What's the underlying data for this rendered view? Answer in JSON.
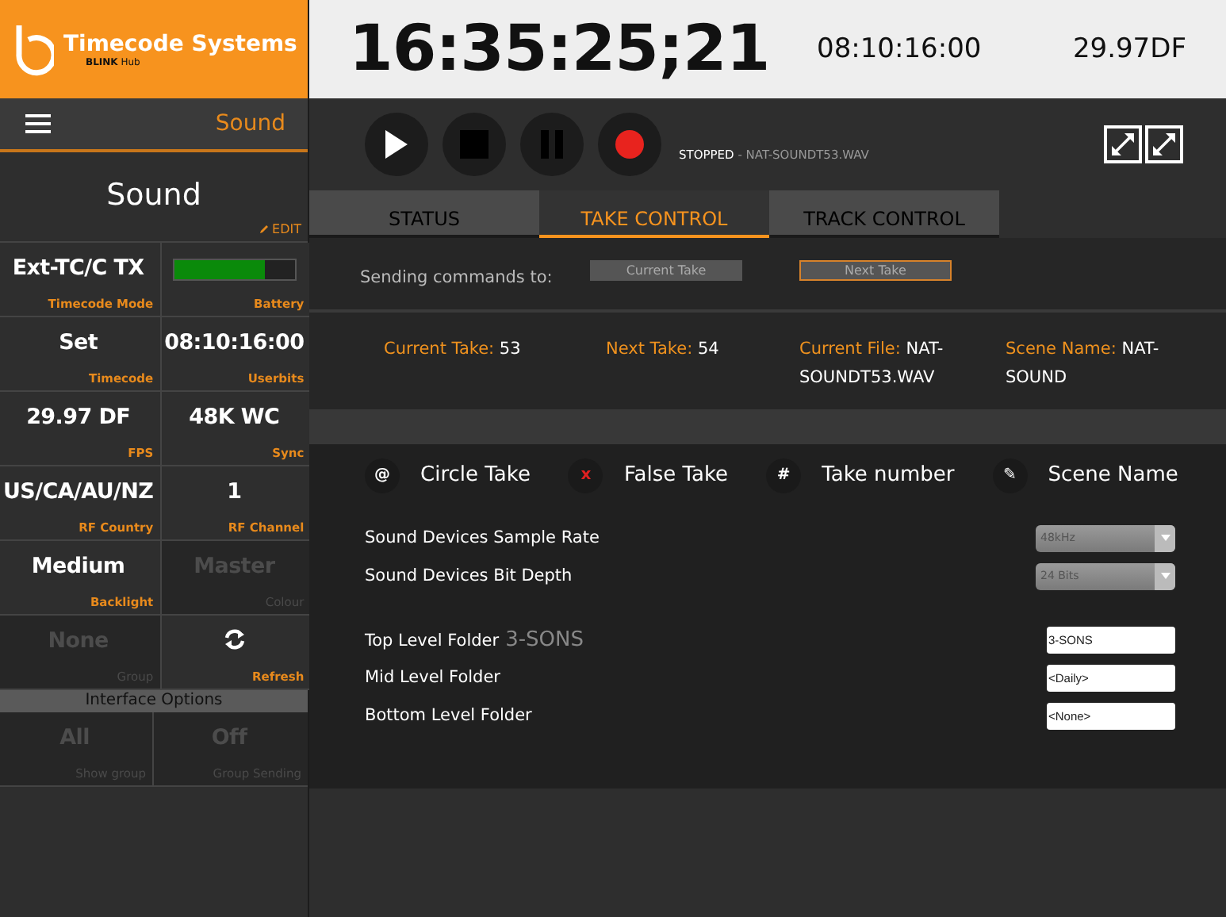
{
  "sidebar": {
    "brand": {
      "name": "Timecode Systems",
      "product": "**BLINK** Hub"
    },
    "menu_title": "Sound",
    "device_name": "Sound",
    "edit_label": "EDIT",
    "cells": [
      {
        "kind": "value",
        "value": "Ext-TC/C TX",
        "label": "Timecode Mode",
        "disabled": false
      },
      {
        "kind": "battery",
        "level": 0.75,
        "label": "Battery",
        "disabled": false
      },
      {
        "kind": "value",
        "value": "Set",
        "label": "Timecode",
        "disabled": false
      },
      {
        "kind": "value",
        "value": "08:10:16:00",
        "label": "Userbits",
        "disabled": false
      },
      {
        "kind": "value",
        "value": "29.97 DF",
        "label": "FPS",
        "disabled": false
      },
      {
        "kind": "value",
        "value": "48K WC",
        "label": "Sync",
        "disabled": false
      },
      {
        "kind": "value",
        "value": "US/CA/AU/NZ",
        "label": "RF Country",
        "disabled": false
      },
      {
        "kind": "value",
        "value": "1",
        "label": "RF Channel",
        "disabled": false
      },
      {
        "kind": "value",
        "value": "Medium",
        "label": "Backlight",
        "disabled": false
      },
      {
        "kind": "value",
        "value": "Master",
        "label": "Colour",
        "disabled": true
      },
      {
        "kind": "value",
        "value": "None",
        "label": "Group",
        "disabled": true
      },
      {
        "kind": "refresh",
        "label": "Refresh",
        "disabled": false
      }
    ],
    "section_title": "Interface Options",
    "option_cells": [
      {
        "kind": "value",
        "value": "All",
        "label": "Show group",
        "disabled": true
      },
      {
        "kind": "value",
        "value": "Off",
        "label": "Group Sending",
        "disabled": true
      }
    ]
  },
  "header": {
    "timecode": "16:35:25;21",
    "userbits": "08:10:16:00",
    "fps": "29.97DF"
  },
  "transport": {
    "buttons": [
      {
        "kind": "play"
      },
      {
        "kind": "stop"
      },
      {
        "kind": "pause"
      },
      {
        "kind": "record"
      }
    ],
    "status": "STOPPED",
    "file": "- NAT-SOUNDT53.WAV"
  },
  "tabs": [
    {
      "label": "STATUS",
      "selected": false
    },
    {
      "label": "TAKE CONTROL",
      "selected": true
    },
    {
      "label": "TRACK CONTROL",
      "selected": false
    }
  ],
  "sending": {
    "label": "Sending commands to:",
    "targets": [
      {
        "label": "Current Take",
        "selected": false
      },
      {
        "label": "Next Take",
        "selected": true
      }
    ]
  },
  "take_info": [
    {
      "label": "Current Take:",
      "value": "53"
    },
    {
      "label": "Next Take:",
      "value": "54"
    },
    {
      "label": "Current File:",
      "value": "NAT-SOUNDT53.WAV"
    },
    {
      "label": "Scene Name:",
      "value": "NAT-SOUND"
    }
  ],
  "actions": [
    {
      "icon": "@",
      "label": "Circle Take",
      "color": "#ffffff"
    },
    {
      "icon": "x",
      "label": "False Take",
      "color": "#e02020"
    },
    {
      "icon": "#",
      "label": "Take number",
      "color": "#ffffff"
    },
    {
      "icon": "✎",
      "label": "Scene Name",
      "color": "#ffffff"
    }
  ],
  "selects": [
    {
      "label": "Sound Devices Sample Rate",
      "value": "48kHz"
    },
    {
      "label": "Sound Devices Bit Depth",
      "value": "24 Bits"
    }
  ],
  "folders": [
    {
      "label": "Top Level Folder",
      "hint": "3-SONS",
      "value": "3-SONS"
    },
    {
      "label": "Mid Level Folder",
      "value": "<Daily>"
    },
    {
      "label": "Bottom Level Folder",
      "value": "<None>"
    }
  ]
}
